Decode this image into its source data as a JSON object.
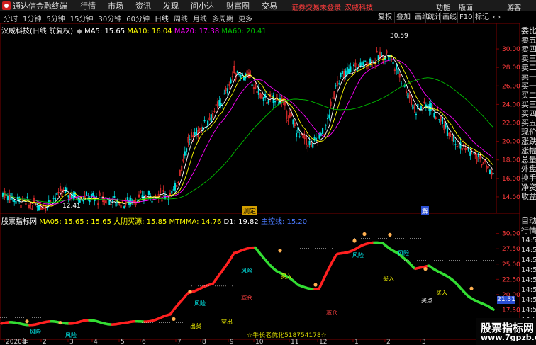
{
  "menubar": {
    "app_name": "通达信金融终端",
    "items": [
      "行情",
      "市场",
      "资讯",
      "发现",
      "问小达",
      "财富圈",
      "交易"
    ],
    "notice": "证券交易未登录",
    "stock_link": "汉威科技",
    "right_items": [
      "功能",
      "版面",
      "游客"
    ]
  },
  "tabs": [
    "分时",
    "1分钟",
    "5分钟",
    "15分钟",
    "30分钟",
    "60分钟",
    "日线",
    "周线",
    "月线",
    "多周期",
    "更多"
  ],
  "active_tab": "日线",
  "toolbar_right": [
    "复权",
    "叠加",
    "画线",
    "统计",
    "画线",
    "F10",
    "标记"
  ],
  "main_chart": {
    "title": "汉威科技(日线 前复权)",
    "ma5_label": "MA5: 15.65",
    "ma10_label": "MA10: 16.04",
    "ma20_label": "MA20: 17.38",
    "ma60_label": "MA60: 20.41",
    "price_high": "30.59",
    "price_low": "12.41",
    "y_ticks": [
      "30.00",
      "28.00",
      "26.00",
      "24.00",
      "22.00",
      "20.00",
      "18.00",
      "16.00",
      "14.00"
    ],
    "markers": [
      "测定",
      "解"
    ]
  },
  "indicator": {
    "title": "股票指标网",
    "ma05_label": "MA05: 15.65",
    "ma15_label": ": 15.65",
    "big_label": "大阴买源: 15.85",
    "mtmma_label": "MTMMA: 14.76",
    "d1_label": "D1: 19.82",
    "flow_label": "主控线: 15.20",
    "y_ticks": [
      "30.00",
      "27.50",
      "25.00",
      "22.50",
      "20.00",
      "17.50",
      "15.00"
    ],
    "signature": "☆牛长老优化518754178☆",
    "current_value": "21.31",
    "labels": [
      "风险",
      "风险",
      "风险",
      "风险",
      "风险",
      "风险",
      "买入",
      "买入",
      "买入",
      "买点",
      "减仓",
      "减仓",
      "出货",
      "突出"
    ]
  },
  "right_panel": {
    "items": [
      "委比",
      "卖五",
      "卖四",
      "卖三",
      "卖二",
      "卖一",
      "买一",
      "买二",
      "买三",
      "买四",
      "买五",
      "现价",
      "涨跌",
      "涨幅",
      "总量",
      "外盘",
      "换手",
      "净资",
      "收益"
    ],
    "lower_items": [
      "自动",
      "行情",
      "14:50",
      "14:50",
      "14:50",
      "14:50",
      "14:50",
      "14:50",
      "14:50",
      "14:50",
      "14:50",
      "14:50",
      "14:50"
    ]
  },
  "time_axis": [
    "2020年",
    "1",
    "2",
    "3",
    "4",
    "5",
    "6",
    "7",
    "8",
    "9",
    "10",
    "11",
    "12",
    "1",
    "2",
    "3"
  ],
  "watermark": {
    "line1": "股票指标网",
    "line2": "www.7gpzb.com"
  },
  "colors": {
    "up": "#ff3232",
    "down": "#00e5e5",
    "ma5": "#ffffff",
    "ma10": "#ffff00",
    "ma20": "#ff00ff",
    "ma60": "#00c000",
    "grid": "#7a0000"
  }
}
